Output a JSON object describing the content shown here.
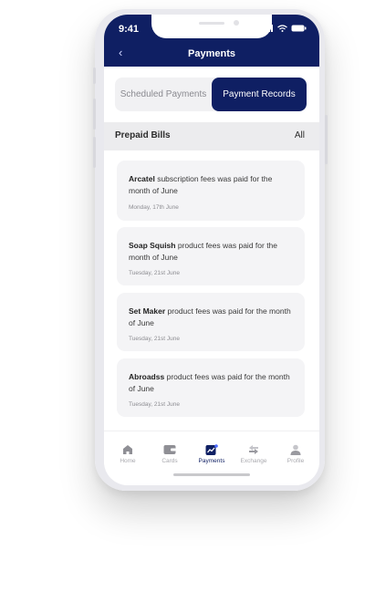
{
  "status_bar": {
    "time": "9:41"
  },
  "header": {
    "title": "Payments",
    "back": "‹"
  },
  "tabs": [
    {
      "label": "Scheduled Payments",
      "active": false
    },
    {
      "label": "Payment Records",
      "active": true
    }
  ],
  "section": {
    "title": "Prepaid Bills",
    "filter": "All"
  },
  "records": [
    {
      "name": "Arcatel",
      "text": "subscription fees was paid for the month of June",
      "date": "Monday, 17th June"
    },
    {
      "name": "Soap Squish",
      "text": "product fees was paid for the month of June",
      "date": "Tuesday, 21st June"
    },
    {
      "name": "Set Maker",
      "text": "product fees was paid for the month of June",
      "date": "Tuesday, 21st June"
    },
    {
      "name": "Abroadss",
      "text": "product fees was paid for the month of June",
      "date": "Tuesday, 21st June"
    }
  ],
  "nav": [
    {
      "label": "Home",
      "icon": "home-icon"
    },
    {
      "label": "Cards",
      "icon": "wallet-icon"
    },
    {
      "label": "Payments",
      "icon": "chart-icon"
    },
    {
      "label": "Exchange",
      "icon": "exchange-icon"
    },
    {
      "label": "Profile",
      "icon": "profile-icon"
    }
  ],
  "colors": {
    "primary": "#0f1f63",
    "inactive": "#a9a9ae"
  }
}
